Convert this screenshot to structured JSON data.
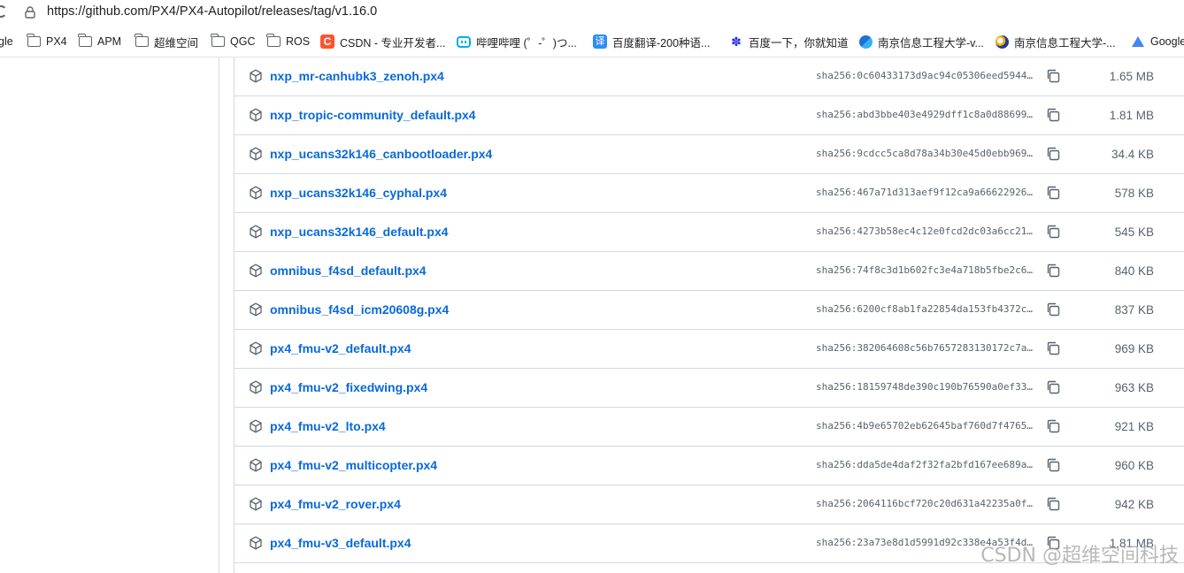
{
  "browser": {
    "url": "https://github.com/PX4/PX4-Autopilot/releases/tag/v1.16.0",
    "bookmarks": [
      {
        "label": "gle",
        "icon": "google-icon"
      },
      {
        "label": "PX4",
        "icon": "folder-icon"
      },
      {
        "label": "APM",
        "icon": "folder-icon"
      },
      {
        "label": "超维空间",
        "icon": "folder-icon"
      },
      {
        "label": "QGC",
        "icon": "folder-icon"
      },
      {
        "label": "ROS",
        "icon": "folder-icon"
      },
      {
        "label": "CSDN - 专业开发者...",
        "icon": "csdn-icon"
      },
      {
        "label": "哔哩哔哩 (゜-゜)つ...",
        "icon": "bilibili-icon"
      },
      {
        "label": "百度翻译-200种语...",
        "icon": "baidu-translate-icon"
      },
      {
        "label": "百度一下，你就知道",
        "icon": "baidu-icon"
      },
      {
        "label": "南京信息工程大学-v...",
        "icon": "nuist-icon"
      },
      {
        "label": "南京信息工程大学-...",
        "icon": "nuist-icon"
      },
      {
        "label": "Google",
        "icon": "google-icon"
      }
    ]
  },
  "assets": [
    {
      "name": "nxp_mr-canhubk3_zenoh.px4",
      "sha": "sha256:0c60433173d9ac94c05306eed5944…",
      "size": "1.65 MB"
    },
    {
      "name": "nxp_tropic-community_default.px4",
      "sha": "sha256:abd3bbe403e4929dff1c8a0d88699…",
      "size": "1.81 MB"
    },
    {
      "name": "nxp_ucans32k146_canbootloader.px4",
      "sha": "sha256:9cdcc5ca8d78a34b30e45d0ebb969…",
      "size": "34.4 KB"
    },
    {
      "name": "nxp_ucans32k146_cyphal.px4",
      "sha": "sha256:467a71d313aef9f12ca9a66622926…",
      "size": "578 KB"
    },
    {
      "name": "nxp_ucans32k146_default.px4",
      "sha": "sha256:4273b58ec4c12e0fcd2dc03a6cc21…",
      "size": "545 KB"
    },
    {
      "name": "omnibus_f4sd_default.px4",
      "sha": "sha256:74f8c3d1b602fc3e4a718b5fbe2c6…",
      "size": "840 KB"
    },
    {
      "name": "omnibus_f4sd_icm20608g.px4",
      "sha": "sha256:6200cf8ab1fa22854da153fb4372c…",
      "size": "837 KB"
    },
    {
      "name": "px4_fmu-v2_default.px4",
      "sha": "sha256:382064608c56b7657283130172c7a…",
      "size": "969 KB"
    },
    {
      "name": "px4_fmu-v2_fixedwing.px4",
      "sha": "sha256:18159748de390c190b76590a0ef33…",
      "size": "963 KB"
    },
    {
      "name": "px4_fmu-v2_lto.px4",
      "sha": "sha256:4b9e65702eb62645baf760d7f4765…",
      "size": "921 KB"
    },
    {
      "name": "px4_fmu-v2_multicopter.px4",
      "sha": "sha256:dda5de4daf2f32fa2bfd167ee689a…",
      "size": "960 KB"
    },
    {
      "name": "px4_fmu-v2_rover.px4",
      "sha": "sha256:2064116bcf720c20d631a42235a0f…",
      "size": "942 KB"
    },
    {
      "name": "px4_fmu-v3_default.px4",
      "sha": "sha256:23a73e8d1d5991d92c338e4a53f4d…",
      "size": "1.81 MB"
    }
  ],
  "watermark": "CSDN @超维空间科技",
  "colors": {
    "link": "#0969da",
    "muted": "#59636e",
    "border": "#d1d9e0"
  }
}
